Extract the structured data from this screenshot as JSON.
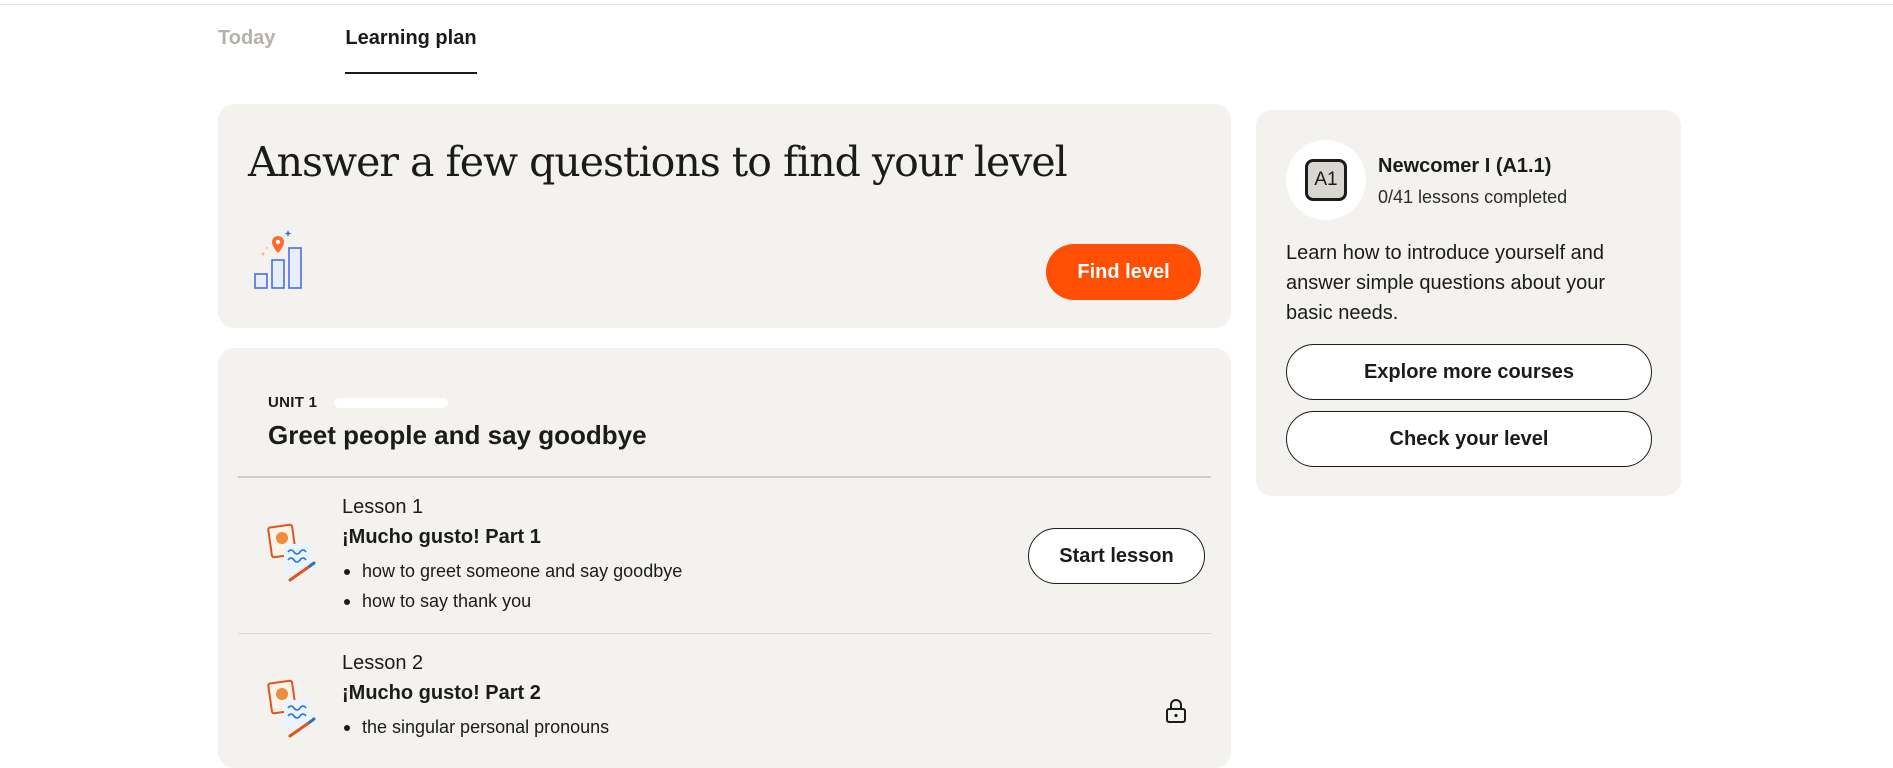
{
  "tabs": [
    {
      "label": "Today",
      "active": false
    },
    {
      "label": "Learning plan",
      "active": true
    }
  ],
  "level_card": {
    "title": "Answer a few questions to find your level",
    "find_button": "Find level",
    "icon": "bar-chart-location-icon"
  },
  "unit": {
    "label": "UNIT 1",
    "progress_fraction": 0,
    "title": "Greet people and say goodbye",
    "lessons": [
      {
        "number": "Lesson 1",
        "name": "¡Mucho gusto! Part 1",
        "bullets": [
          "how to greet someone and say goodbye",
          "how to say thank you"
        ],
        "action": "Start lesson",
        "icon": "lesson-illustration-icon"
      },
      {
        "number": "Lesson 2",
        "name": "¡Mucho gusto! Part 2",
        "bullets": [
          "the singular personal pronouns"
        ],
        "locked": true,
        "icon": "lesson-illustration-icon"
      }
    ]
  },
  "course": {
    "badge": "A1",
    "name": "Newcomer I (A1.1)",
    "progress": "0/41 lessons completed",
    "description": "Learn how to introduce yourself and answer simple questions about your basic needs.",
    "explore_button": "Explore more courses",
    "check_button": "Check your level"
  },
  "colors": {
    "accent": "#ff4f05",
    "card_bg": "#f4f2ee",
    "text": "#1b1b1b",
    "inactive_tab": "#b5b2ab"
  }
}
